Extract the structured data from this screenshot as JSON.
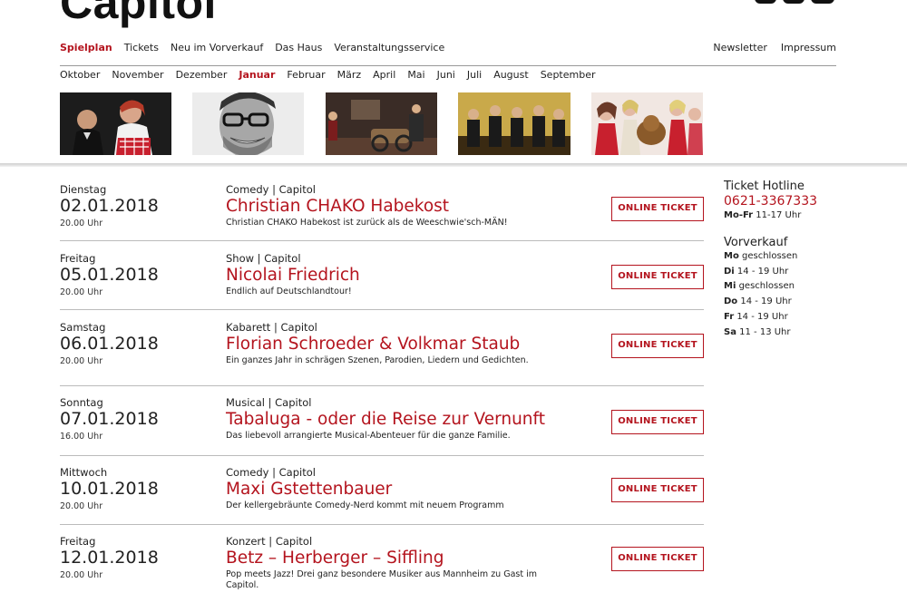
{
  "header": {
    "logo": "Capitol",
    "nav_left": [
      {
        "label": "Spielplan",
        "active": true
      },
      {
        "label": "Tickets",
        "active": false
      },
      {
        "label": "Neu im Vorverkauf",
        "active": false
      },
      {
        "label": "Das Haus",
        "active": false
      },
      {
        "label": "Veranstaltungsservice",
        "active": false
      }
    ],
    "nav_right": [
      "Newsletter",
      "Impressum"
    ],
    "months": [
      "Oktober",
      "November",
      "Dezember",
      "Januar",
      "Februar",
      "März",
      "April",
      "Mai",
      "Juni",
      "Juli",
      "August",
      "September"
    ],
    "active_month": "Januar"
  },
  "events": [
    {
      "weekday": "Dienstag",
      "date": "02.01.2018",
      "time": "20.00 Uhr",
      "category": "Comedy | Capitol",
      "title": "Christian CHAKO Habekost",
      "description": "Christian CHAKO Habekost ist zurück als de Weeschwie'sch-MÄN!",
      "button": "ONLINE TICKET"
    },
    {
      "weekday": "Freitag",
      "date": "05.01.2018",
      "time": "20.00 Uhr",
      "category": "Show | Capitol",
      "title": "Nicolai Friedrich",
      "description": "Endlich auf Deutschlandtour!",
      "button": "ONLINE TICKET"
    },
    {
      "weekday": "Samstag",
      "date": "06.01.2018",
      "time": "20.00 Uhr",
      "category": "Kabarett | Capitol",
      "title": "Florian Schroeder & Volkmar Staub",
      "description": "Ein ganzes Jahr in schrägen Szenen, Parodien, Liedern und Gedichten.",
      "button": "ONLINE TICKET"
    },
    {
      "weekday": "Sonntag",
      "date": "07.01.2018",
      "time": "16.00 Uhr",
      "category": "Musical | Capitol",
      "title": "Tabaluga - oder die Reise zur Vernunft",
      "description": "Das liebevoll arrangierte Musical-Abenteuer für die ganze Familie.",
      "button": "ONLINE TICKET"
    },
    {
      "weekday": "Mittwoch",
      "date": "10.01.2018",
      "time": "20.00 Uhr",
      "category": "Comedy | Capitol",
      "title": "Maxi Gstettenbauer",
      "description": "Der kellergebräunte Comedy-Nerd kommt mit neuem Programm",
      "button": "ONLINE TICKET"
    },
    {
      "weekday": "Freitag",
      "date": "12.01.2018",
      "time": "20.00 Uhr",
      "category": "Konzert | Capitol",
      "title": "Betz – Herberger – Siffling",
      "description": "Pop meets Jazz! Drei ganz besondere Musiker aus Mannheim zu Gast im Capitol.",
      "button": "ONLINE TICKET"
    }
  ],
  "sidebar": {
    "hotline_heading": "Ticket Hotline",
    "hotline_phone": "0621-3367333",
    "hotline_hours_days": "Mo-Fr",
    "hotline_hours_time": "11-17 Uhr",
    "presale_heading": "Vorverkauf",
    "presale_hours": [
      {
        "day": "Mo",
        "hours": "geschlossen"
      },
      {
        "day": "Di",
        "hours": "14 - 19 Uhr"
      },
      {
        "day": "Mi",
        "hours": "geschlossen"
      },
      {
        "day": "Do",
        "hours": "14 - 19 Uhr"
      },
      {
        "day": "Fr",
        "hours": "14 - 19 Uhr"
      },
      {
        "day": "Sa",
        "hours": "11 - 13 Uhr"
      }
    ]
  },
  "colors": {
    "accent": "#b4141e",
    "text": "#222222",
    "rule": "#bbbbbb"
  }
}
